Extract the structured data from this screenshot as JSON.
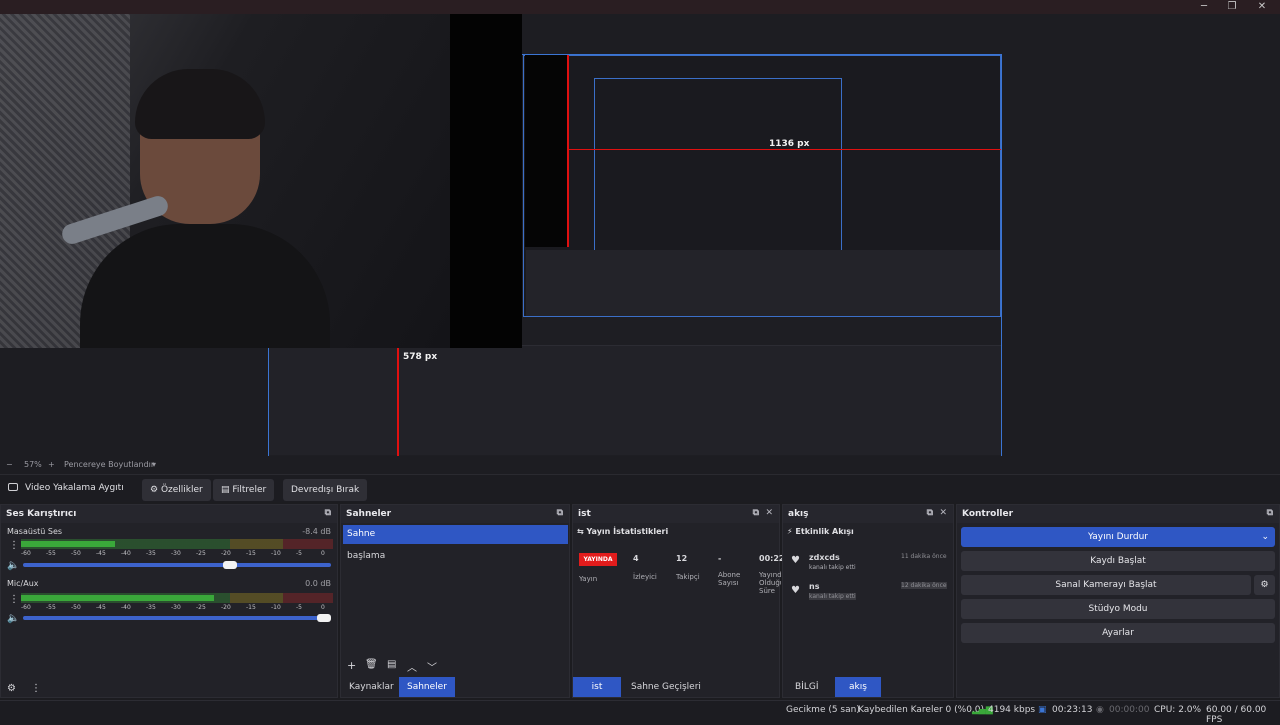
{
  "window": {
    "minimize": "─",
    "maximize": "❐",
    "close": "✕"
  },
  "preview": {
    "measure_width": "1136 px",
    "measure_height": "578 px"
  },
  "zoombar": {
    "minus": "−",
    "zoom": "57%",
    "plus": "+",
    "fit": "Pencereye Boyutlandır",
    "menu": "▾"
  },
  "source_toolbar": {
    "source_name": "Video Yakalama Aygıtı",
    "properties": "Özellikler",
    "filters": "Filtreler",
    "deactivate": "Devredışı Bırak"
  },
  "mixer": {
    "title": "Ses Karıştırıcı",
    "channels": [
      {
        "name": "Masaüstü Ses",
        "db": "-8.4 dB",
        "level": 0.3,
        "volume": 0.68
      },
      {
        "name": "Mic/Aux",
        "db": "0.0 dB",
        "level": 0.62,
        "volume": 1.0
      }
    ],
    "scale": [
      "-60",
      "-55",
      "-50",
      "-45",
      "-40",
      "-35",
      "-30",
      "-25",
      "-20",
      "-15",
      "-10",
      "-5",
      "0"
    ]
  },
  "scenes": {
    "title": "Sahneler",
    "items": [
      "Sahne",
      "başlama"
    ],
    "tab_sources": "Kaynaklar",
    "tab_scenes": "Sahneler"
  },
  "stats": {
    "title": "ist",
    "subtitle": "Yayın İstatistikleri",
    "live_badge": "YAYINDA",
    "live_label": "Yayın",
    "viewers_value": "4",
    "viewers_label": "İzleyici",
    "followers_value": "12",
    "followers_label": "Takipçi",
    "subs_value": "-",
    "subs_label": "Abone Sayısı",
    "uptime_value": "00:22",
    "uptime_label": "Yayında Olduğu Süre",
    "tab_ist": "ist",
    "tab_transitions": "Sahne Geçişleri"
  },
  "feed": {
    "title": "akış",
    "subtitle": "Etkinlik Akışı",
    "events": [
      {
        "user": "zdxcds",
        "action": "kanalı takip etti",
        "time": "11 dakika önce"
      },
      {
        "user": "ns",
        "action": "kanalı takip etti",
        "time": "12 dakika önce"
      }
    ],
    "tab_info": "BİLGİ",
    "tab_feed": "akış"
  },
  "controls": {
    "title": "Kontroller",
    "stop_stream": "Yayını Durdur",
    "start_recording": "Kaydı Başlat",
    "start_virtualcam": "Sanal Kamerayı Başlat",
    "studio_mode": "Stüdyo Modu",
    "settings": "Ayarlar"
  },
  "status": {
    "delay": "Gecikme (5 san)",
    "dropped": "Kaybedilen Kareler 0 (%0.0)",
    "bitrate": "4194 kbps",
    "stream_time": "00:23:13",
    "rec_time": "00:00:00",
    "cpu": "CPU: 2.0%",
    "fps": "60.00 / 60.00 FPS"
  },
  "colors": {
    "accent": "#2f57c4",
    "live": "#e21c1c",
    "meter_green": "#3aa83a",
    "meter_yellow": "#b8a020",
    "meter_red": "#b82828"
  }
}
